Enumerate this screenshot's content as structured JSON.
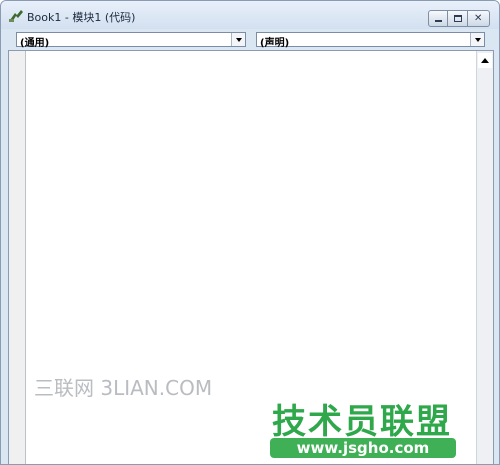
{
  "window": {
    "title": "Book1 - 模块1 (代码)",
    "icon": "vba-module-icon"
  },
  "caption_buttons": {
    "minimize": "minimize-icon",
    "maximize": "maximize-icon",
    "close": "close-icon"
  },
  "object_combo": {
    "value": "(通用)"
  },
  "procedure_combo": {
    "value": "(声明)"
  },
  "watermarks": {
    "left": "三联网 3LIAN.COM",
    "brand": "技术员联盟",
    "url": "www.jsgho.com"
  },
  "colors": {
    "titlebar": "#d3e0f0",
    "watermark_green": "#2ea84a"
  }
}
